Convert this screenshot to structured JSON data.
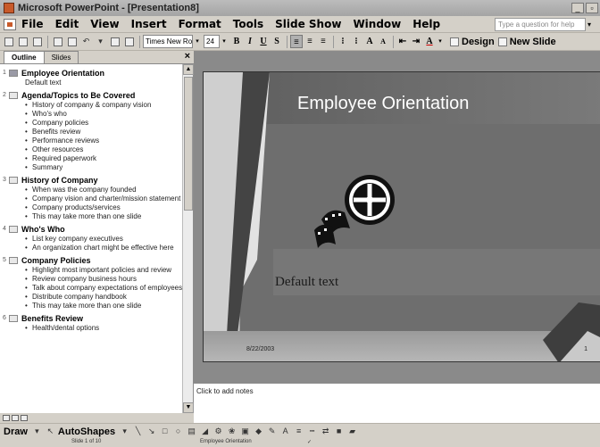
{
  "window": {
    "title": "Microsoft PowerPoint - [Presentation8]"
  },
  "menu": {
    "items": [
      "File",
      "Edit",
      "View",
      "Insert",
      "Format",
      "Tools",
      "Slide Show",
      "Window",
      "Help"
    ],
    "help_placeholder": "Type a question for help"
  },
  "toolbar": {
    "font_name": "Times New Roman",
    "font_size": "24",
    "bold": "B",
    "italic": "I",
    "underline": "U",
    "shadow": "S",
    "grow_font": "A",
    "shrink_font": "A",
    "font_color": "A",
    "design_label": "Design",
    "new_slide_label": "New Slide"
  },
  "pane": {
    "tabs": [
      "Outline",
      "Slides"
    ],
    "active_tab": "Outline",
    "close_symbol": "×"
  },
  "outline": [
    {
      "num": "1",
      "title": "Employee Orientation",
      "subtitle": "Default text",
      "bullets": []
    },
    {
      "num": "2",
      "title": "Agenda/Topics to Be Covered",
      "bullets": [
        "History of company & company vision",
        "Who's who",
        "Company policies",
        "Benefits review",
        "Performance reviews",
        "Other resources",
        "Required paperwork",
        "Summary"
      ]
    },
    {
      "num": "3",
      "title": "History of Company",
      "bullets": [
        "When was the company founded",
        "Company vision and charter/mission statement",
        "Company products/services",
        "This may take more than one slide"
      ]
    },
    {
      "num": "4",
      "title": "Who's Who",
      "bullets": [
        "List key company executives",
        "An organization chart might be effective here"
      ]
    },
    {
      "num": "5",
      "title": "Company Policies",
      "bullets": [
        "Highlight most important policies and review",
        "Review company business hours",
        "Talk about company expectations of employees",
        "Distribute company handbook",
        "This may take more than one slide"
      ]
    },
    {
      "num": "6",
      "title": "Benefits Review",
      "bullets": [
        "Health/dental options"
      ]
    }
  ],
  "slide": {
    "title": "Employee Orientation",
    "subtitle": "Default text",
    "date": "8/22/2003",
    "page_number": "1"
  },
  "notes": {
    "placeholder": "Click to add notes"
  },
  "drawing": {
    "draw_label": "Draw",
    "autoshapes_label": "AutoShapes"
  },
  "status": {
    "slide_position": "Slide 1 of 10",
    "design_name": "Employee Orientation"
  },
  "colors": {
    "chrome": "#d4d0c8",
    "slide_background": "#6e6e6e",
    "slide_title": "#ffffff"
  }
}
